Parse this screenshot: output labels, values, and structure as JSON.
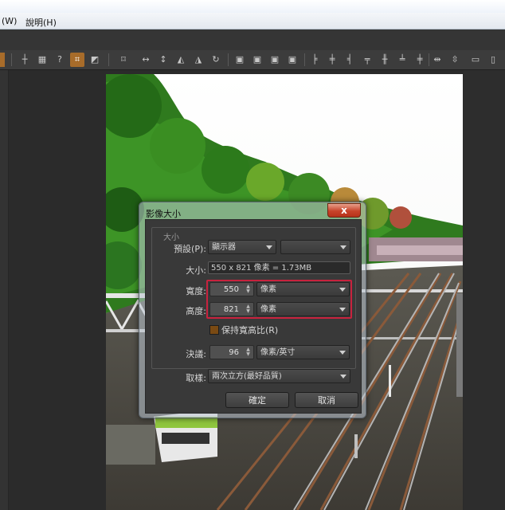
{
  "menu": {
    "partial_item": "(W)",
    "help": "說明(H)"
  },
  "toolbar_icons": [
    "frame-icon",
    "rectangle-tool-icon",
    "question-grid-icon",
    "crop-icon",
    "straighten-icon",
    "transform-icon",
    "flip-horizontal-icon",
    "flip-vertical-icon",
    "rotate-left-icon",
    "rotate-right-icon",
    "rotate-180-icon",
    "align-1-icon",
    "align-2-icon",
    "align-3-icon",
    "align-4-icon",
    "align-left-icon",
    "align-center-icon",
    "align-top-icon",
    "align-middle-icon",
    "align-bottom-icon",
    "distribute-h-icon",
    "distribute-v-icon",
    "fit-icon",
    "more-icon"
  ],
  "dialog": {
    "title": "影像大小",
    "close_label": "x",
    "group_label": "大小",
    "preset": {
      "label": "預設(P):",
      "value": "顯示器",
      "value2": ""
    },
    "size": {
      "label": "大小:",
      "value": "550 x 821 像素 = 1.73MB"
    },
    "width": {
      "label": "寬度:",
      "value": "550",
      "unit": "像素"
    },
    "height": {
      "label": "高度:",
      "value": "821",
      "unit": "像素"
    },
    "keep_ratio": {
      "label": "保持寬高比(R)",
      "checked": true
    },
    "resolution": {
      "label": "決議:",
      "value": "96",
      "unit": "像素/英寸"
    },
    "resample": {
      "label": "取樣:",
      "value": "兩次立方(最好品質)"
    },
    "ok_label": "確定",
    "cancel_label": "取消"
  }
}
